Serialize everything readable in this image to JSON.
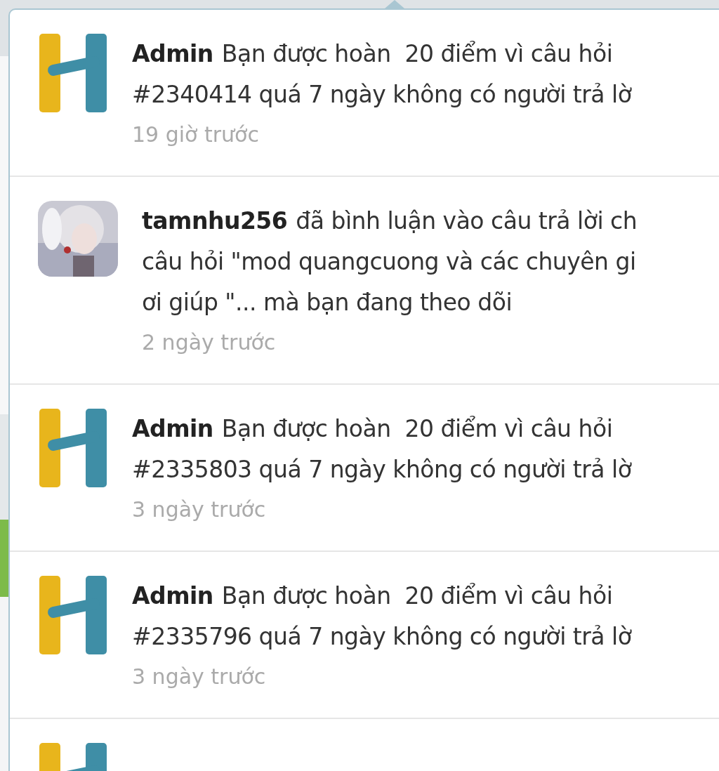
{
  "notifications": [
    {
      "kind": "logo",
      "user": "Admin",
      "lines": [
        "Bạn được hoàn  20 điểm vì câu hỏi",
        "#2340414 quá 7 ngày không có người trả lờ"
      ],
      "time": "19 giờ trước"
    },
    {
      "kind": "picture",
      "user": "tamnhu256",
      "lines": [
        "đã bình luận vào câu trả lời ch",
        "câu hỏi \"mod quangcuong và các chuyên gi",
        "ơi giúp \"... mà bạn đang theo dõi"
      ],
      "time": "2 ngày trước"
    },
    {
      "kind": "logo",
      "user": "Admin",
      "lines": [
        "Bạn được hoàn  20 điểm vì câu hỏi",
        "#2335803 quá 7 ngày không có người trả lờ"
      ],
      "time": "3 ngày trước"
    },
    {
      "kind": "logo",
      "user": "Admin",
      "lines": [
        "Bạn được hoàn  20 điểm vì câu hỏi",
        "#2335796 quá 7 ngày không có người trả lờ"
      ],
      "time": "3 ngày trước"
    },
    {
      "kind": "logo"
    }
  ]
}
